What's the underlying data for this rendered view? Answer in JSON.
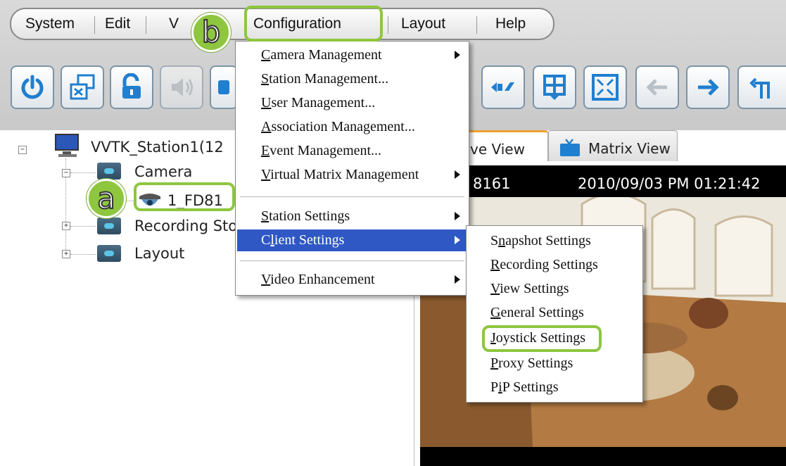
{
  "menubar": {
    "items": [
      {
        "label": "System"
      },
      {
        "label": "Edit"
      },
      {
        "label": "V"
      },
      {
        "label": "Configuration"
      },
      {
        "label": "Layout"
      },
      {
        "label": "Help"
      }
    ]
  },
  "toolbar": {
    "buttons": [
      "power-icon",
      "cascade-window-icon",
      "unlock-icon",
      "speaker-icon",
      "partial-button-icon",
      "ptz-icon",
      "grid-layout-icon",
      "fullscreen-icon",
      "back-arrow-icon",
      "forward-arrow-icon",
      "patrol-icon"
    ]
  },
  "tree": {
    "station": "VVTK_Station1(12",
    "camera_folder": "Camera",
    "camera_item": "1_FD81",
    "recording_folder": "Recording Sto",
    "layout_folder": "Layout"
  },
  "tabs": {
    "live_view": "ve View",
    "matrix_view": "Matrix View"
  },
  "camera": {
    "name": "8161",
    "timestamp": "2010/09/03 PM 01:21:42"
  },
  "config_menu": {
    "items": [
      {
        "label": "Camera Management",
        "mnemonic": "C",
        "rest": "amera Management",
        "submenu": true
      },
      {
        "label": "Station Management...",
        "mnemonic": "S",
        "rest": "tation Management...",
        "submenu": false
      },
      {
        "label": "User Management...",
        "mnemonic": "U",
        "rest": "ser Management...",
        "submenu": false
      },
      {
        "label": "Association Management...",
        "mnemonic": "A",
        "rest": "ssociation Management...",
        "submenu": false
      },
      {
        "label": "Event Management...",
        "mnemonic": "E",
        "rest": "vent Management...",
        "submenu": false
      },
      {
        "label": "Virtual Matrix Management",
        "mnemonic": "V",
        "rest": "irtual Matrix Management",
        "submenu": true
      },
      {
        "label": "Station Settings",
        "mnemonic": "S",
        "rest": "tation Settings",
        "submenu": true
      },
      {
        "label": "Client Settings",
        "mnemonic": "l",
        "pre": "C",
        "rest": "ient Settings",
        "submenu": true
      },
      {
        "label": "Video Enhancement",
        "mnemonic": "V",
        "rest": "ideo Enhancement",
        "submenu": true
      }
    ]
  },
  "client_settings_submenu": {
    "items": [
      {
        "pre": "S",
        "mnemonic": "n",
        "rest": "apshot Settings"
      },
      {
        "pre": "",
        "mnemonic": "R",
        "rest": "ecording Settings"
      },
      {
        "pre": "",
        "mnemonic": "V",
        "rest": "iew Settings"
      },
      {
        "pre": "",
        "mnemonic": "G",
        "rest": "eneral Settings"
      },
      {
        "pre": "",
        "mnemonic": "J",
        "rest": "oystick Settings"
      },
      {
        "pre": "",
        "mnemonic": "P",
        "rest": "roxy Settings"
      },
      {
        "pre": "P",
        "mnemonic": "i",
        "rest": "P Settings"
      }
    ]
  },
  "callouts": {
    "a": "a",
    "b": "b"
  },
  "colors": {
    "highlight": "#8ec63f",
    "menu_selection": "#2f58c4",
    "toolbar_border": "#7b93a8"
  }
}
